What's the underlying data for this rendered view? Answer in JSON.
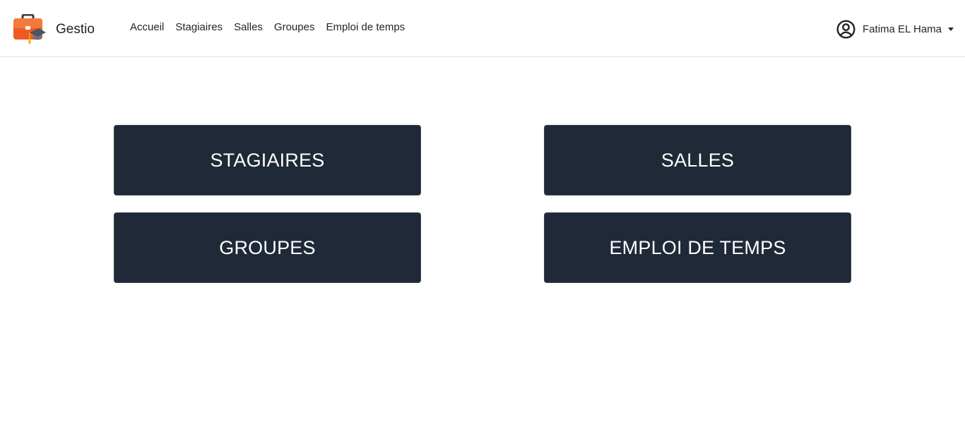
{
  "navbar": {
    "brand": "Gestio",
    "brand_icon": "briefcase-graduation-icon",
    "links": [
      {
        "label": "Accueil"
      },
      {
        "label": "Stagiaires"
      },
      {
        "label": "Salles"
      },
      {
        "label": "Groupes"
      },
      {
        "label": "Emploi de temps"
      }
    ],
    "user": {
      "name": "Fatima EL Hama",
      "icon": "user-circle-icon"
    }
  },
  "tiles": [
    {
      "label": "STAGIAIRES"
    },
    {
      "label": "SALLES"
    },
    {
      "label": "GROUPES"
    },
    {
      "label": "EMPLOI DE TEMPS"
    }
  ],
  "colors": {
    "tile_background": "#1f2937",
    "tile_text": "#ffffff",
    "brand_orange": "#ef5a24"
  }
}
